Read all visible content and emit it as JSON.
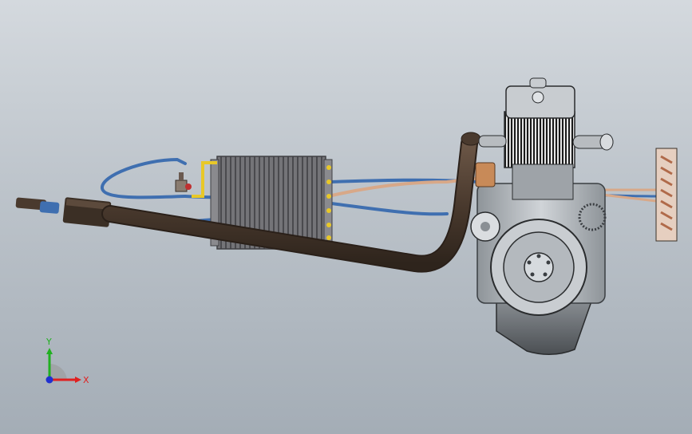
{
  "viewport": {
    "background_top": "#d4d9de",
    "background_bottom": "#a4adb6"
  },
  "colors": {
    "exhaust_pipe": "#4a3a2e",
    "coolant_hose": "#3f6fb0",
    "copper_line": "#d8a888",
    "engine_body": "#b9bec3",
    "radiator": "#6e6e72",
    "yellow_line": "#e8c828",
    "axis_x": "#e02020",
    "axis_y": "#20b020",
    "axis_z": "#2030d0"
  },
  "triad": {
    "x_label": "X",
    "y_label": "Y"
  }
}
